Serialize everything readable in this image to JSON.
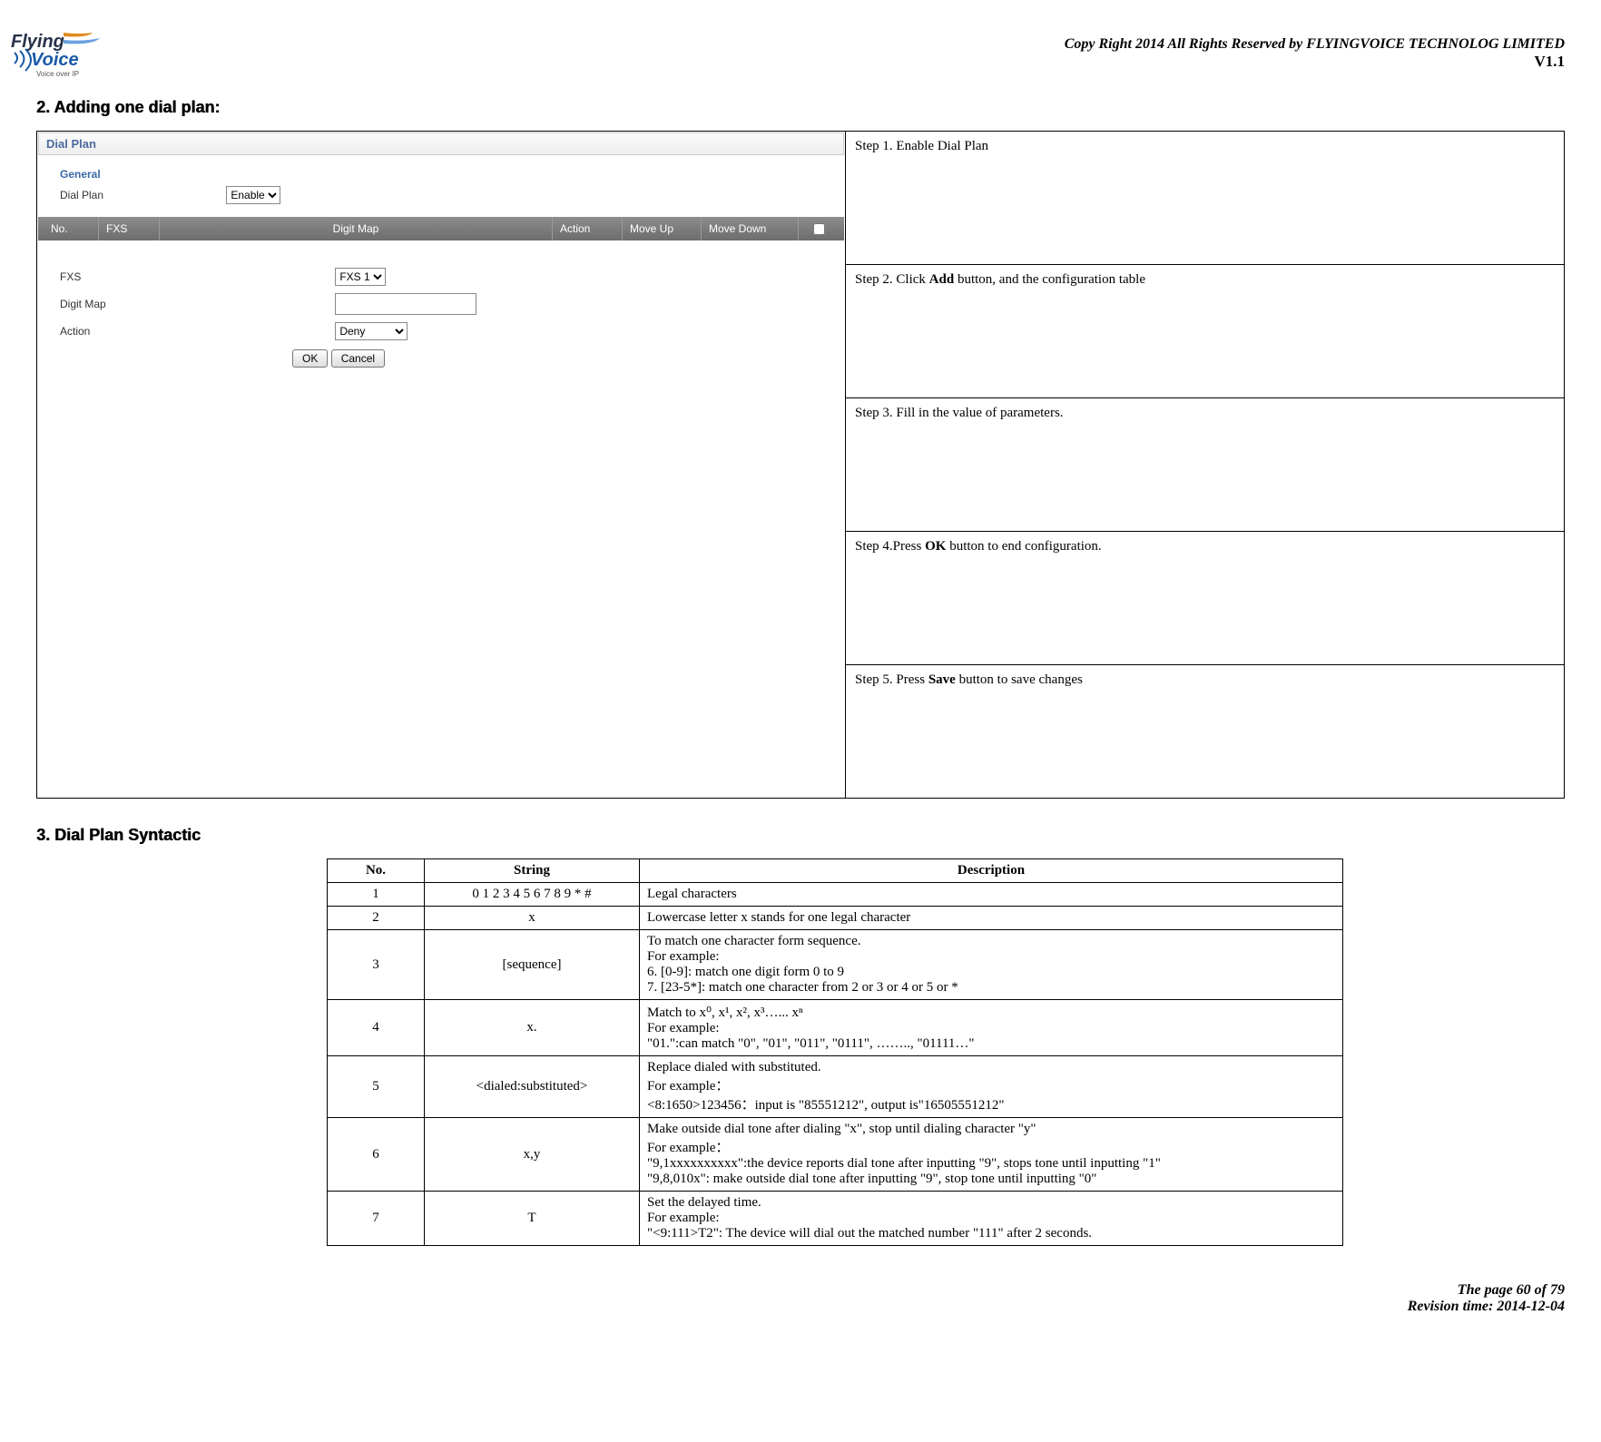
{
  "header": {
    "logo_alt": "FlyingVoice Voice over IP",
    "copyright": "Copy Right 2014 All Rights Reserved by FLYINGVOICE TECHNOLOG LIMITED",
    "version": "V1.1"
  },
  "sections": {
    "s2_title": "2.  Adding one dial plan:",
    "s3_title": "3.  Dial Plan Syntactic"
  },
  "ui": {
    "panel_title": "Dial Plan",
    "general_label": "General",
    "dial_plan_label": "Dial Plan",
    "dial_plan_value": "Enable",
    "grid": {
      "no": "No.",
      "fxs": "FXS",
      "digit_map": "Digit Map",
      "action": "Action",
      "move_up": "Move Up",
      "move_down": "Move Down"
    },
    "form": {
      "fxs_label": "FXS",
      "fxs_value": "FXS 1",
      "digit_map_label": "Digit Map",
      "digit_map_value": "",
      "action_label": "Action",
      "action_value": "Deny"
    },
    "buttons": {
      "ok": "OK",
      "cancel": "Cancel"
    }
  },
  "steps": {
    "s1_pre": "Step 1. Enable Dial Plan",
    "s2_pre": "Step 2. Click ",
    "s2_bold": "Add",
    "s2_post": " button, and the configuration table",
    "s3": "Step 3. Fill in the value of parameters.",
    "s4_pre": "Step 4.Press ",
    "s4_bold": "OK",
    "s4_post": " button to end configuration.",
    "s5_pre": "Step 5. Press ",
    "s5_bold": "Save",
    "s5_post": " button to save changes"
  },
  "syntactic": {
    "headers": {
      "no": "No.",
      "string": "String",
      "description": "Description"
    },
    "rows": [
      {
        "no": "1",
        "str": "0 1 2 3 4 5 6 7 8 9 * #",
        "desc": "Legal characters"
      },
      {
        "no": "2",
        "str": "x",
        "desc": "Lowercase letter x stands for one legal character"
      },
      {
        "no": "3",
        "str": "[sequence]",
        "desc": "To match one character form sequence.\nFor example:\n6.        [0-9]: match one digit form 0 to 9\n7.        [23-5*]: match one character from 2 or 3 or 4 or 5 or *"
      },
      {
        "no": "4",
        "str": "x.",
        "desc": "Match to x⁰, x¹, x², x³…... xⁿ\nFor example:\n\"01.\":can match \"0\", \"01\", \"011\", \"0111\",  …….., \"01111…\""
      },
      {
        "no": "5",
        "str": "<dialed:substituted>",
        "desc": "Replace dialed with substituted.\nFor example：\n<8:1650>123456：input is \"85551212\", output is\"16505551212\""
      },
      {
        "no": "6",
        "str": "x,y",
        "desc": "Make outside dial tone after dialing \"x\", stop until dialing character \"y\"\nFor example：\n\"9,1xxxxxxxxxx\":the device reports dial tone after inputting \"9\", stops tone until inputting \"1\"\n\"9,8,010x\": make outside dial tone after inputting \"9\", stop tone until inputting \"0\""
      },
      {
        "no": "7",
        "str": "T",
        "desc": "Set the delayed time.\nFor example:\n\"<9:111>T2\": The device will dial out the matched number \"111\" after 2 seconds."
      }
    ]
  },
  "footer": {
    "page": "The page 60 of 79",
    "rev": "Revision time: 2014-12-04"
  }
}
